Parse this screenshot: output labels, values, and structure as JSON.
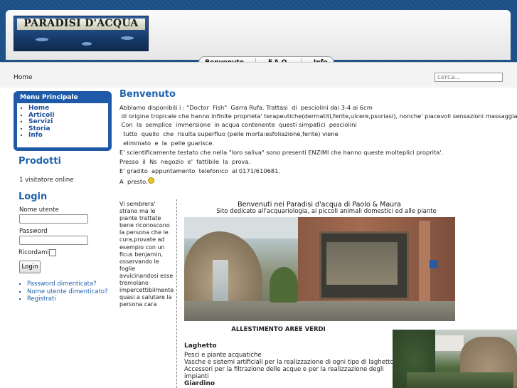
{
  "header": {
    "logo_text": "PARADISI D'ACQUA",
    "nav": [
      "Benvenuto",
      "F.A.Q.",
      "Info"
    ]
  },
  "breadcrumb": "Home",
  "search": {
    "placeholder": "cerca..."
  },
  "menu": {
    "title": "Menu Principale",
    "items": [
      "Home",
      "Articoli",
      "Servizi",
      "Storia",
      "Info"
    ]
  },
  "prodotti": {
    "title": "Prodotti",
    "visitors": "1 visitatore online"
  },
  "login": {
    "title": "Login",
    "username_label": "Nome utente",
    "password_label": "Password",
    "remember_label": "Ricordami",
    "button": "Login",
    "links": [
      "Password dimenticata?",
      "Nome utente dimenticato?",
      "Registrati"
    ]
  },
  "main": {
    "title": "Benvenuto",
    "lines": [
      "Abbiamo disponibili i : \"Doctor  Fish\"  Garra Rufa. Trattasi  di  pesciolini dai 3-4 ai 6cm",
      " di origine tropicale che hanno infinite proprieta' terapeutiche(dermatiti,ferite,ulcere,psoriasi), nonche' piacevoli sensazioni massaggianti.",
      " Con  la  semplice  immersione  in acqua contenente  questi simpatici  pesciolini",
      "  tutto  quello  che  risulta superfluo (pelle morta:esfoliazione,ferite) viene",
      "  eliminato  e  la  pelle guarisce.",
      "E' scientificamente testato che nella \"loro saliva\" sono presenti ENZIMI che hanno queste molteplici proprita'.",
      "Presso  il  Ns  negozio  e'  fattibile  la  prova.",
      "E' gradito  appuntamento  telefonico  al 0171/610681."
    ],
    "closing": "A  presto.",
    "quote": "Vi sembrera' strano ma le piante trattate bene riconoscono la persona che le cura,provate ad esempio con un ficus benjamin, osservando le foglie avvicinandosi esse tremolano impercettibilmente quasi a salutare la persona cara"
  },
  "feature": {
    "title": "Benvenuti nei Paradisi d'acqua di Paolo & Maura",
    "subtitle": "Sito dedicato all'acquariologia, ai piccoli animali domestici ed alle piante",
    "areas_title": "ALLESTIMENTO AREE VERDI",
    "laghetto_title": "Laghetto",
    "laghetto_lines": [
      "Pesci e piante acquatiche",
      "Vasche e sistemi artificiali per la realizzazione di ogni tipo di laghetto",
      "Accessori per la filtrazione delle acque e per la realizzazione degli",
      "impianti"
    ],
    "giardino_title": "Giardino"
  }
}
